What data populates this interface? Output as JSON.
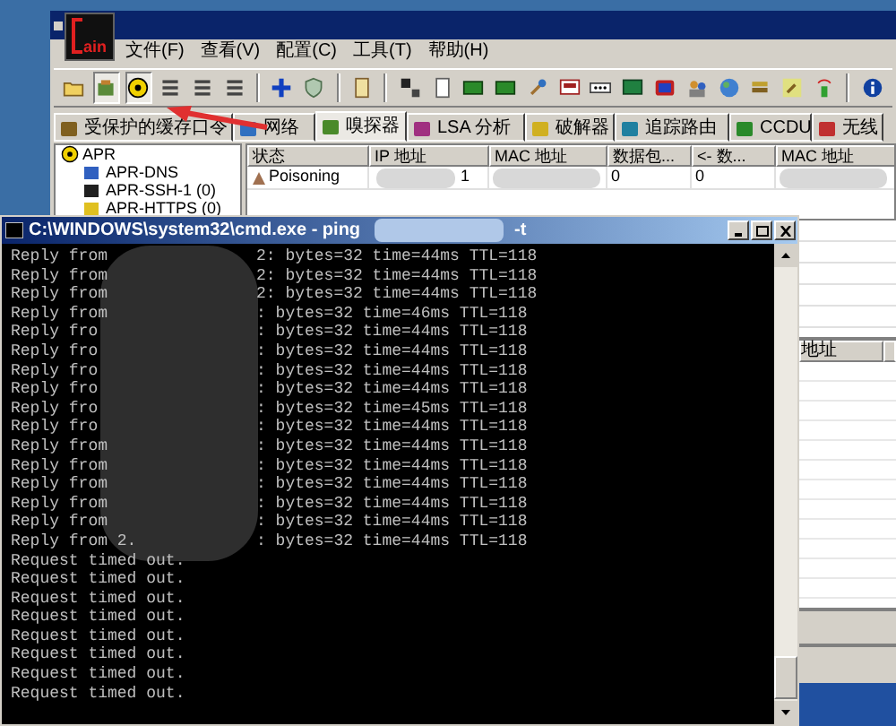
{
  "cain": {
    "logo_text": "ain",
    "menu": [
      "文件(F)",
      "查看(V)",
      "配置(C)",
      "工具(T)",
      "帮助(H)"
    ],
    "toolbar": [
      {
        "pressed": false
      },
      {
        "pressed": true
      },
      {
        "pressed": true
      },
      {
        "pressed": false
      },
      {
        "pressed": false
      },
      {
        "pressed": false
      },
      {
        "pressed": false
      },
      {
        "pressed": false
      },
      {
        "pressed": false
      },
      {
        "pressed": false
      },
      {
        "pressed": false
      },
      {
        "pressed": false
      },
      {
        "pressed": false
      },
      {
        "pressed": false
      },
      {
        "pressed": false
      },
      {
        "pressed": false
      },
      {
        "pressed": false
      },
      {
        "pressed": false
      },
      {
        "pressed": false
      },
      {
        "pressed": false
      },
      {
        "pressed": false
      },
      {
        "pressed": false
      },
      {
        "pressed": false
      },
      {
        "pressed": false
      }
    ],
    "tabs": [
      {
        "label": "受保护的缓存口令",
        "selected": false
      },
      {
        "label": "网络",
        "selected": false
      },
      {
        "label": "嗅探器",
        "selected": true
      },
      {
        "label": "LSA 分析",
        "selected": false
      },
      {
        "label": "破解器",
        "selected": false
      },
      {
        "label": "追踪路由",
        "selected": false
      },
      {
        "label": "CCDU",
        "selected": false
      },
      {
        "label": "无线",
        "selected": false
      }
    ],
    "tree": {
      "label": "APR",
      "children": [
        {
          "label": "APR-DNS"
        },
        {
          "label": "APR-SSH-1 (0)"
        },
        {
          "label": "APR-HTTPS (0)"
        }
      ]
    },
    "table": {
      "columns": [
        "状态",
        "IP 地址",
        "MAC 地址",
        "数据包...",
        "<- 数...",
        "MAC 地址"
      ],
      "rows": [
        {
          "status": "Poisoning",
          "ip": "1",
          "packets_out": "0",
          "packets_in": "0"
        }
      ]
    },
    "lower_table": {
      "columns": [
        "地址"
      ]
    }
  },
  "cmd": {
    "title": "C:\\WINDOWS\\system32\\cmd.exe - ping",
    "title_end": "-t",
    "lines": [
      {
        "start": "Reply from",
        "end": "2: bytes=32 time=44ms TTL=118"
      },
      {
        "start": "Reply from",
        "end": "2: bytes=32 time=44ms TTL=118"
      },
      {
        "start": "Reply from",
        "end": "2: bytes=32 time=44ms TTL=118"
      },
      {
        "start": "Reply from",
        "end": ": bytes=32 time=46ms TTL=118"
      },
      {
        "start": "Reply fro",
        "end": ": bytes=32 time=44ms TTL=118"
      },
      {
        "start": "Reply fro",
        "end": ": bytes=32 time=44ms TTL=118"
      },
      {
        "start": "Reply fro",
        "end": ": bytes=32 time=44ms TTL=118"
      },
      {
        "start": "Reply fro",
        "end": ": bytes=32 time=44ms TTL=118"
      },
      {
        "start": "Reply fro",
        "end": ": bytes=32 time=45ms TTL=118"
      },
      {
        "start": "Reply fro",
        "end": ": bytes=32 time=44ms TTL=118"
      },
      {
        "start": "Reply from",
        "end": ": bytes=32 time=44ms TTL=118"
      },
      {
        "start": "Reply from",
        "end": ": bytes=32 time=44ms TTL=118"
      },
      {
        "start": "Reply from",
        "end": ": bytes=32 time=44ms TTL=118"
      },
      {
        "start": "Reply from",
        "end": ": bytes=32 time=44ms TTL=118"
      },
      {
        "start": "Reply from",
        "end": ": bytes=32 time=44ms TTL=118"
      },
      {
        "start": "Reply from 2.",
        "end": ": bytes=32 time=44ms TTL=118"
      },
      {
        "start": "Request timed out."
      },
      {
        "start": "Request timed out."
      },
      {
        "start": "Request timed out."
      },
      {
        "start": "Request timed out."
      },
      {
        "start": "Request timed out."
      },
      {
        "start": "Request timed out."
      },
      {
        "start": "Request timed out."
      },
      {
        "start": "Request timed out."
      }
    ]
  }
}
